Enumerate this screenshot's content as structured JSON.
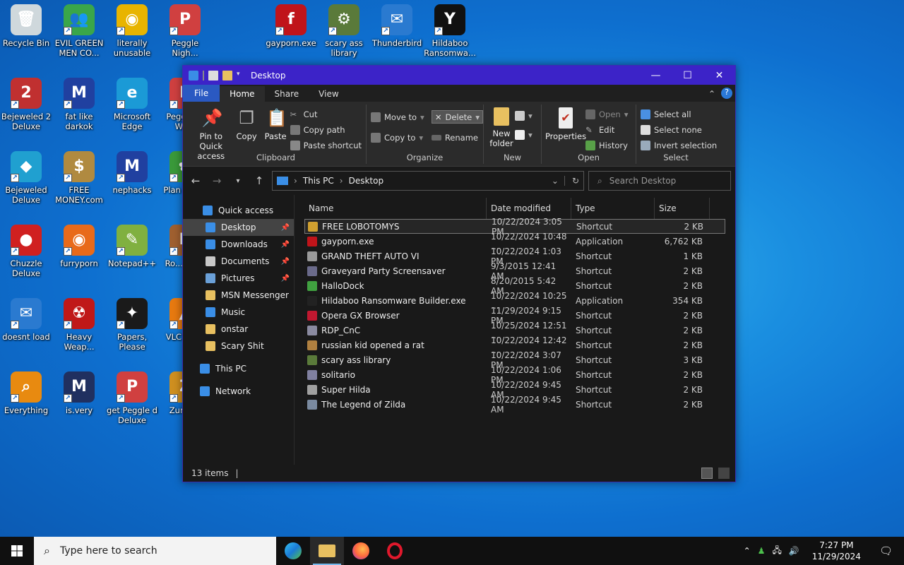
{
  "desktop_icons": [
    {
      "label": "Recycle Bin",
      "icon": "recycle-bin-icon",
      "color": "#cfd8dc",
      "glyph": "🗑"
    },
    {
      "label": "EVIL GREEN MEN CO...",
      "icon": "msn-people-icon",
      "color": "#3aa64a",
      "glyph": "👥"
    },
    {
      "label": "literally unusable",
      "icon": "chrome-icon",
      "color": "#e8b400",
      "glyph": "◉"
    },
    {
      "label": "Peggle Nigh...",
      "icon": "peggle-icon",
      "color": "#d04040",
      "glyph": "P"
    },
    {
      "label": "gayporn.exe",
      "icon": "flash-icon",
      "color": "#c0141a",
      "glyph": "f"
    },
    {
      "label": "scary ass library",
      "icon": "library-icon",
      "color": "#5a7a3a",
      "glyph": "⚙"
    },
    {
      "label": "Thunderbird",
      "icon": "thunderbird-icon",
      "color": "#2a7ad0",
      "glyph": "✉"
    },
    {
      "label": "Hildaboo Ransomwa...",
      "icon": "yashma-icon",
      "color": "#111111",
      "glyph": "Y"
    },
    {
      "label": "Bejeweled 2 Deluxe",
      "icon": "bejeweled2-icon",
      "color": "#c03030",
      "glyph": "2"
    },
    {
      "label": "fat like darkok",
      "icon": "mpi-icon",
      "color": "#2040a0",
      "glyph": "M"
    },
    {
      "label": "Microsoft Edge",
      "icon": "edge-icon",
      "color": "#1b9ad6",
      "glyph": "e"
    },
    {
      "label": "Peggle of Wa...",
      "icon": "peggle-icon",
      "color": "#d04040",
      "glyph": "P"
    },
    {
      "label": "Bejeweled Deluxe",
      "icon": "bejeweled-icon",
      "color": "#20a0d0",
      "glyph": "◆"
    },
    {
      "label": "FREE MONEY.com",
      "icon": "money-bag-icon",
      "color": "#b08a40",
      "glyph": "$"
    },
    {
      "label": "nephacks",
      "icon": "mpi-icon",
      "color": "#2040a0",
      "glyph": "M"
    },
    {
      "label": "Plan Zon...",
      "icon": "plants-icon",
      "color": "#3a9a3a",
      "glyph": "✿"
    },
    {
      "label": "Chuzzle Deluxe",
      "icon": "chuzzle-icon",
      "color": "#d02020",
      "glyph": "●"
    },
    {
      "label": "furryporn",
      "icon": "firefox-icon",
      "color": "#e86a1a",
      "glyph": "◉"
    },
    {
      "label": "Notepad++",
      "icon": "notepadpp-icon",
      "color": "#80b040",
      "glyph": "✎"
    },
    {
      "label": "Ro... Ma...",
      "icon": "app-icon",
      "color": "#a06030",
      "glyph": "R"
    },
    {
      "label": "doesnt load",
      "icon": "thunderbird-icon",
      "color": "#2a7ad0",
      "glyph": "✉"
    },
    {
      "label": "Heavy Weap...",
      "icon": "radiation-icon",
      "color": "#c01818",
      "glyph": "☢"
    },
    {
      "label": "Papers, Please",
      "icon": "papers-please-icon",
      "color": "#1a1a1a",
      "glyph": "✦"
    },
    {
      "label": "VLC pla...",
      "icon": "vlc-icon",
      "color": "#e87a10",
      "glyph": "▲"
    },
    {
      "label": "Everything",
      "icon": "everything-search-icon",
      "color": "#e88a10",
      "glyph": "⌕"
    },
    {
      "label": "is.very",
      "icon": "mpi-shield-icon",
      "color": "#203060",
      "glyph": "M"
    },
    {
      "label": "get Peggle d Deluxe",
      "icon": "peggle-icon",
      "color": "#d04040",
      "glyph": "P"
    },
    {
      "label": "Zuma...",
      "icon": "zuma-icon",
      "color": "#d09020",
      "glyph": "Z"
    }
  ],
  "window": {
    "title": "Desktop",
    "tabs": {
      "file": "File",
      "home": "Home",
      "share": "Share",
      "view": "View"
    },
    "ribbon": {
      "clipboard": {
        "label": "Clipboard",
        "pin": "Pin to Quick access",
        "copy": "Copy",
        "paste": "Paste",
        "cut": "Cut",
        "copy_path": "Copy path",
        "paste_shortcut": "Paste shortcut"
      },
      "organize": {
        "label": "Organize",
        "move_to": "Move to",
        "copy_to": "Copy to",
        "delete": "Delete",
        "rename": "Rename"
      },
      "new": {
        "label": "New",
        "new_folder": "New folder"
      },
      "open": {
        "label": "Open",
        "properties": "Properties",
        "open": "Open",
        "edit": "Edit",
        "history": "History"
      },
      "select": {
        "label": "Select",
        "select_all": "Select all",
        "select_none": "Select none",
        "invert": "Invert selection"
      }
    },
    "address": {
      "root": "This PC",
      "current": "Desktop",
      "search_placeholder": "Search Desktop"
    },
    "nav": [
      {
        "label": "Quick access",
        "icon": "star-icon",
        "color": "#3a8ee6",
        "sub": false,
        "sel": false,
        "pin": false
      },
      {
        "label": "Desktop",
        "icon": "desktop-icon",
        "color": "#3a8ee6",
        "sub": true,
        "sel": true,
        "pin": true
      },
      {
        "label": "Downloads",
        "icon": "download-icon",
        "color": "#3a8ee6",
        "sub": true,
        "sel": false,
        "pin": true
      },
      {
        "label": "Documents",
        "icon": "documents-icon",
        "color": "#c8c8c8",
        "sub": true,
        "sel": false,
        "pin": true
      },
      {
        "label": "Pictures",
        "icon": "pictures-icon",
        "color": "#6aa0d8",
        "sub": true,
        "sel": false,
        "pin": true
      },
      {
        "label": "MSN Messenger",
        "icon": "folder-icon",
        "color": "#e8c060",
        "sub": true,
        "sel": false,
        "pin": false
      },
      {
        "label": "Music",
        "icon": "music-icon",
        "color": "#3a8ee6",
        "sub": true,
        "sel": false,
        "pin": false
      },
      {
        "label": "onstar",
        "icon": "folder-icon",
        "color": "#e8c060",
        "sub": true,
        "sel": false,
        "pin": false
      },
      {
        "label": "Scary Shit",
        "icon": "folder-icon",
        "color": "#e8c060",
        "sub": true,
        "sel": false,
        "pin": false
      },
      {
        "label": "This PC",
        "icon": "computer-icon",
        "color": "#3a8ee6",
        "sub": false,
        "sel": false,
        "pin": false
      },
      {
        "label": "Network",
        "icon": "network-icon",
        "color": "#3a8ee6",
        "sub": false,
        "sel": false,
        "pin": false
      }
    ],
    "columns": {
      "name": "Name",
      "date": "Date modified",
      "type": "Type",
      "size": "Size"
    },
    "files": [
      {
        "name": "FREE LOBOTOMYS",
        "date": "10/22/2024 3:05 PM",
        "type": "Shortcut",
        "size": "2 KB",
        "color": "#d0a030",
        "icon": "shortcut-icon"
      },
      {
        "name": "gayporn.exe",
        "date": "10/22/2024 10:48 ...",
        "type": "Application",
        "size": "6,762 KB",
        "color": "#c0141a",
        "icon": "flash-icon"
      },
      {
        "name": "GRAND THEFT AUTO VI",
        "date": "10/22/2024 1:03 PM",
        "type": "Shortcut",
        "size": "1 KB",
        "color": "#9a9a9a",
        "icon": "shortcut-icon"
      },
      {
        "name": "Graveyard Party Screensaver",
        "date": "9/3/2015 12:41 AM",
        "type": "Shortcut",
        "size": "2 KB",
        "color": "#6a6a8a",
        "icon": "shortcut-icon"
      },
      {
        "name": "HalloDock",
        "date": "8/20/2015 5:42 AM",
        "type": "Shortcut",
        "size": "2 KB",
        "color": "#40a040",
        "icon": "shortcut-icon"
      },
      {
        "name": "Hildaboo Ransomware Builder.exe",
        "date": "10/22/2024 10:25 ...",
        "type": "Application",
        "size": "354 KB",
        "color": "#222222",
        "icon": "app-icon"
      },
      {
        "name": "Opera GX Browser",
        "date": "11/29/2024 9:15 PM",
        "type": "Shortcut",
        "size": "2 KB",
        "color": "#c01830",
        "icon": "opera-icon"
      },
      {
        "name": "RDP_CnC",
        "date": "10/25/2024 12:51 ...",
        "type": "Shortcut",
        "size": "2 KB",
        "color": "#8a8aa0",
        "icon": "shortcut-icon"
      },
      {
        "name": "russian kid opened a rat",
        "date": "10/22/2024 12:42 ...",
        "type": "Shortcut",
        "size": "2 KB",
        "color": "#b08040",
        "icon": "shortcut-icon"
      },
      {
        "name": "scary ass library",
        "date": "10/22/2024 3:07 PM",
        "type": "Shortcut",
        "size": "3 KB",
        "color": "#5a7a3a",
        "icon": "shortcut-icon"
      },
      {
        "name": "solitario",
        "date": "10/22/2024 1:06 PM",
        "type": "Shortcut",
        "size": "2 KB",
        "color": "#8080a0",
        "icon": "shortcut-icon"
      },
      {
        "name": "Super Hilda",
        "date": "10/22/2024 9:45 AM",
        "type": "Shortcut",
        "size": "2 KB",
        "color": "#a0a0a0",
        "icon": "shortcut-icon"
      },
      {
        "name": "The Legend of Zilda",
        "date": "10/22/2024 9:45 AM",
        "type": "Shortcut",
        "size": "2 KB",
        "color": "#7a8aa0",
        "icon": "shortcut-icon"
      }
    ],
    "status": "13 items"
  },
  "taskbar": {
    "search_placeholder": "Type here to search",
    "time": "7:27 PM",
    "date": "11/29/2024"
  }
}
